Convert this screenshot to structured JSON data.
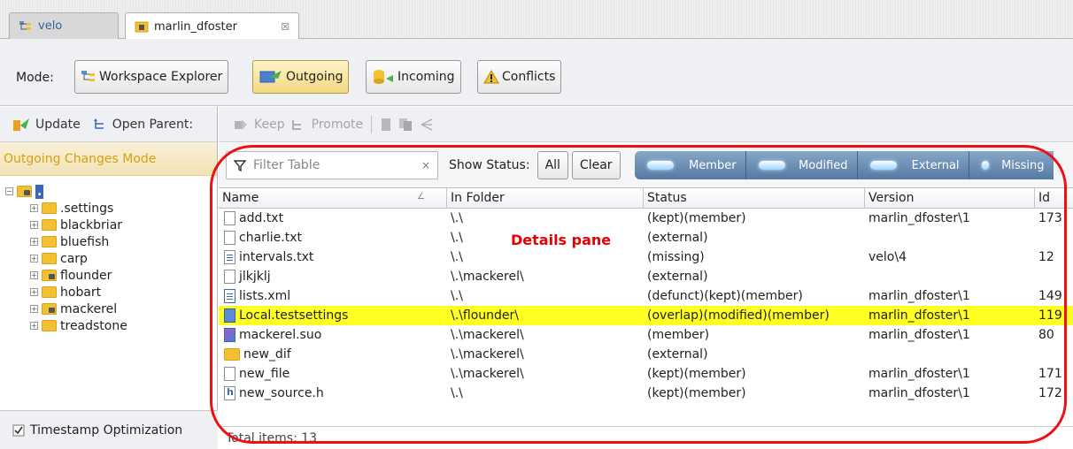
{
  "tabs": [
    {
      "label": "velo"
    },
    {
      "label": "marlin_dfoster",
      "close": "☒"
    }
  ],
  "mode": {
    "label": "Mode:",
    "buttons": [
      {
        "label": "Workspace Explorer"
      },
      {
        "label": "Outgoing"
      },
      {
        "label": "Incoming"
      },
      {
        "label": "Conflicts"
      }
    ]
  },
  "left": {
    "toolbar": {
      "update": "Update",
      "open_parent": "Open Parent:"
    },
    "header": "Outgoing Changes Mode",
    "tree": {
      "root": ".",
      "items": [
        ".settings",
        "blackbriar",
        "bluefish",
        "carp",
        "flounder",
        "hobart",
        "mackerel",
        "treadstone"
      ]
    },
    "footer": "Timestamp Optimization"
  },
  "right_toolbar": {
    "keep": "Keep",
    "promote": "Promote"
  },
  "details": {
    "filter_placeholder": "Filter Table",
    "filter_clear": "×",
    "show_status": "Show Status:",
    "all": "All",
    "clear": "Clear",
    "status_chips": [
      "Member",
      "Modified",
      "External",
      "Missing"
    ],
    "columns": [
      "Name",
      "In Folder",
      "Status",
      "Version",
      "Id"
    ],
    "rows": [
      [
        "add.txt",
        "\\.\\",
        "(kept)(member)",
        "marlin_dfoster\\1",
        "173"
      ],
      [
        "charlie.txt",
        "\\.\\",
        "(external)",
        "",
        ""
      ],
      [
        "intervals.txt",
        "\\.\\",
        "(missing)",
        "velo\\4",
        "12"
      ],
      [
        "jlkjklj",
        "\\.\\mackerel\\",
        "(external)",
        "",
        ""
      ],
      [
        "lists.xml",
        "\\.\\",
        "(defunct)(kept)(member)",
        "marlin_dfoster\\1",
        "149"
      ],
      [
        "Local.testsettings",
        "\\.\\flounder\\",
        "(overlap)(modified)(member)",
        "marlin_dfoster\\1",
        "119"
      ],
      [
        "mackerel.suo",
        "\\.\\mackerel\\",
        "(member)",
        "marlin_dfoster\\1",
        "80"
      ],
      [
        "new_dif",
        "\\.\\mackerel\\",
        "(external)",
        "",
        ""
      ],
      [
        "new_file",
        "\\.\\mackerel\\",
        "(kept)(member)",
        "marlin_dfoster\\1",
        "171"
      ],
      [
        "new_source.h",
        "\\.\\",
        "(kept)(member)",
        "marlin_dfoster\\1",
        "172"
      ]
    ],
    "footer": "Total items: 13"
  },
  "annotation": {
    "label": "Details pane",
    "color": "#ee1111"
  }
}
